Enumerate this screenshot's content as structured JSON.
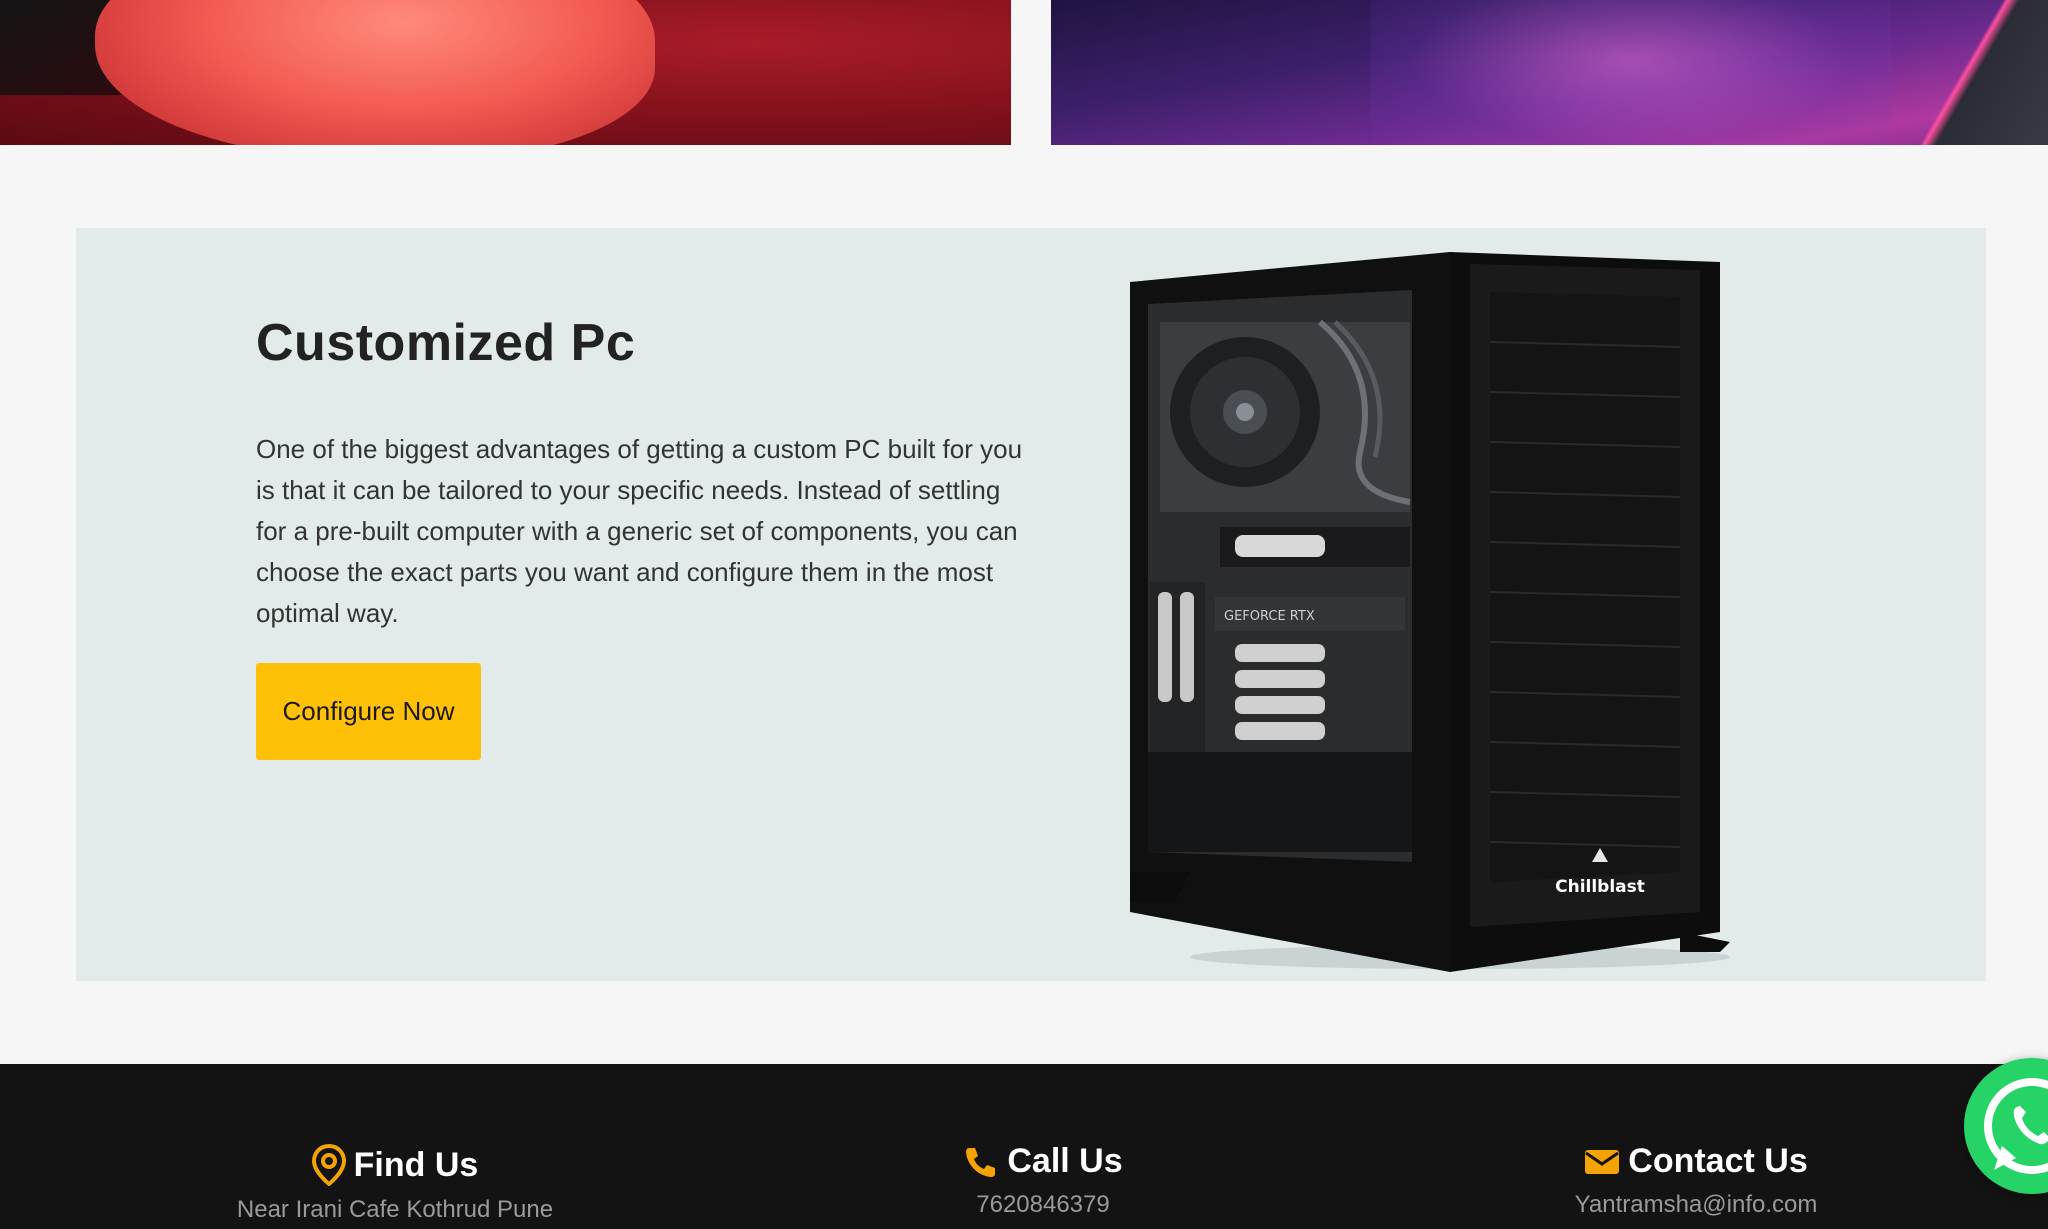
{
  "promo": {
    "title": "Customized Pc",
    "description": "One of the biggest advantages of getting a custom PC built for you is that it can be tailored to your specific needs. Instead of settling for a pre-built computer with a generic set of components, you can choose the exact parts you want and configure them in the most optimal way.",
    "cta_label": "Configure Now",
    "image": {
      "brand_text": "Chillblast",
      "gpu_text": "GEFORCE RTX"
    }
  },
  "footer": {
    "find_us": {
      "title": "Find Us",
      "value": "Near Irani Cafe Kothrud Pune",
      "icon": "location-pin-icon"
    },
    "call_us": {
      "title": "Call Us",
      "value": "7620846379",
      "icon": "phone-icon"
    },
    "contact_us": {
      "title": "Contact Us",
      "value": "Yantramsha@info.com",
      "icon": "envelope-icon"
    }
  },
  "floating": {
    "icon": "whatsapp-icon"
  },
  "colors": {
    "accent": "#ffc107",
    "icon_orange": "#f5a300",
    "footer_bg": "#131313",
    "promo_bg": "#e2eaea",
    "whatsapp": "#25d366"
  }
}
